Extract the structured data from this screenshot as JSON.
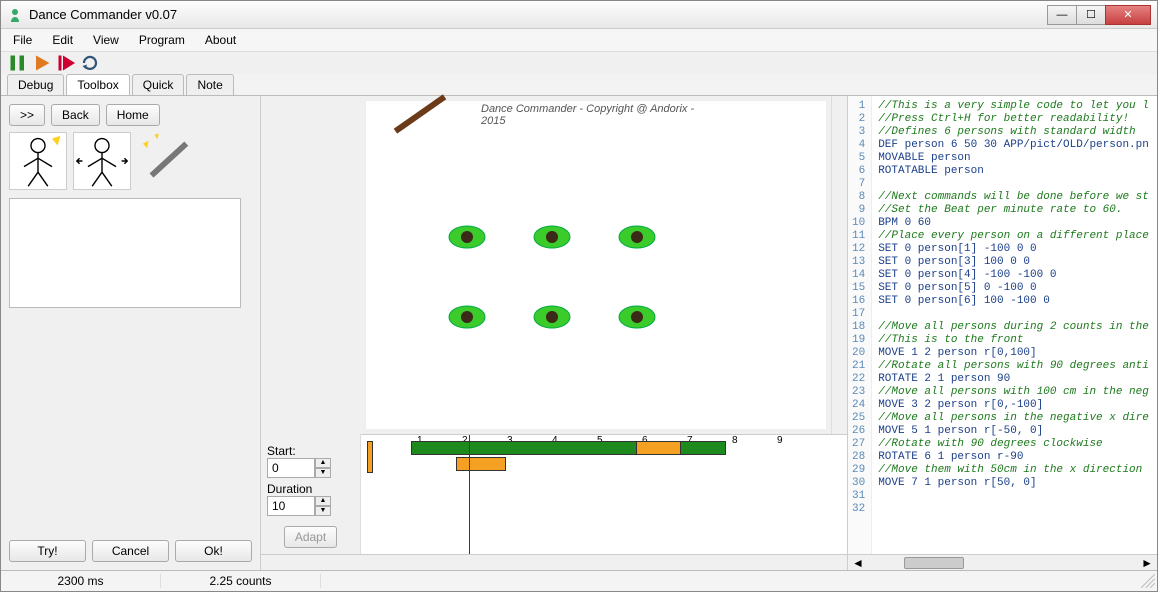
{
  "window": {
    "title": "Dance Commander v0.07"
  },
  "menu": {
    "file": "File",
    "edit": "Edit",
    "view": "View",
    "program": "Program",
    "about": "About"
  },
  "tabs": {
    "debug": "Debug",
    "toolbox": "Toolbox",
    "quick": "Quick",
    "note": "Note"
  },
  "nav": {
    "fwd": ">>",
    "back": "Back",
    "home": "Home"
  },
  "actions": {
    "try": "Try!",
    "cancel": "Cancel",
    "ok": "Ok!"
  },
  "stage": {
    "caption": "Dance Commander - Copyright @ Andorix - 2015"
  },
  "props": {
    "start_label": "Start:",
    "start_value": "0",
    "duration_label": "Duration",
    "duration_value": "10",
    "adapt": "Adapt"
  },
  "timeline": {
    "ticks": [
      "1",
      "2",
      "3",
      "4",
      "5",
      "6",
      "7",
      "8",
      "9"
    ]
  },
  "status": {
    "time": "2300 ms",
    "counts": "2.25 counts"
  },
  "code": {
    "lines": [
      {
        "n": 1,
        "cls": "c",
        "t": "//This is a very simple code to let you l"
      },
      {
        "n": 2,
        "cls": "c",
        "t": "//Press Ctrl+H for better readability!"
      },
      {
        "n": 3,
        "cls": "c",
        "t": "//Defines 6 persons with standard width"
      },
      {
        "n": 4,
        "cls": "k",
        "t": "DEF person 6 50 30 APP/pict/OLD/person.pn"
      },
      {
        "n": 5,
        "cls": "k",
        "t": "MOVABLE person"
      },
      {
        "n": 6,
        "cls": "k",
        "t": "ROTATABLE person"
      },
      {
        "n": 7,
        "cls": "",
        "t": ""
      },
      {
        "n": 8,
        "cls": "c",
        "t": "//Next commands will be done before we st"
      },
      {
        "n": 9,
        "cls": "c",
        "t": "//Set the Beat per minute rate to 60."
      },
      {
        "n": 10,
        "cls": "k",
        "t": "BPM 0 60"
      },
      {
        "n": 11,
        "cls": "c",
        "t": "//Place every person on a different place"
      },
      {
        "n": 12,
        "cls": "k",
        "t": "SET 0 person[1] -100 0 0"
      },
      {
        "n": 13,
        "cls": "k",
        "t": "SET 0 person[3] 100 0 0"
      },
      {
        "n": 14,
        "cls": "k",
        "t": "SET 0 person[4] -100 -100 0"
      },
      {
        "n": 15,
        "cls": "k",
        "t": "SET 0 person[5] 0 -100 0"
      },
      {
        "n": 16,
        "cls": "k",
        "t": "SET 0 person[6] 100 -100 0"
      },
      {
        "n": 17,
        "cls": "",
        "t": ""
      },
      {
        "n": 18,
        "cls": "c",
        "t": "//Move all persons during 2 counts in the"
      },
      {
        "n": 19,
        "cls": "c",
        "t": "//This is to the front"
      },
      {
        "n": 20,
        "cls": "k",
        "t": "MOVE 1 2 person r[0,100]"
      },
      {
        "n": 21,
        "cls": "c",
        "t": "//Rotate all persons with 90 degrees anti"
      },
      {
        "n": 22,
        "cls": "k",
        "t": "ROTATE 2 1 person 90"
      },
      {
        "n": 23,
        "cls": "c",
        "t": "//Move all persons with 100 cm in the neg"
      },
      {
        "n": 24,
        "cls": "k",
        "t": "MOVE 3 2 person r[0,-100]"
      },
      {
        "n": 25,
        "cls": "c",
        "t": "//Move all persons in the negative x dire"
      },
      {
        "n": 26,
        "cls": "k",
        "t": "MOVE 5 1 person r[-50, 0]"
      },
      {
        "n": 27,
        "cls": "c",
        "t": "//Rotate with 90 degrees clockwise"
      },
      {
        "n": 28,
        "cls": "k",
        "t": "ROTATE 6 1 person r-90"
      },
      {
        "n": 29,
        "cls": "c",
        "t": "//Move them with 50cm in the x direction"
      },
      {
        "n": 30,
        "cls": "k",
        "t": "MOVE 7 1 person r[50, 0]"
      },
      {
        "n": 31,
        "cls": "",
        "t": ""
      },
      {
        "n": 32,
        "cls": "",
        "t": ""
      }
    ]
  }
}
